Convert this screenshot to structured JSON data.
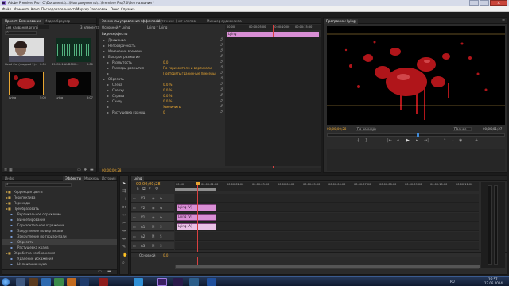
{
  "titlebar": {
    "title": "Adobe Premiere Pro - C:\\Documents\\...\\Мои документы\\...\\Premiere Pro\\7.0\\Без названия *"
  },
  "menu": [
    "Файл",
    "Изменить",
    "Клип",
    "Последовательность",
    "Маркер",
    "Заголовок",
    "Окно",
    "Справка"
  ],
  "project": {
    "tabs": [
      "Проект: Без названия",
      "Медиа-браузер"
    ],
    "field": "Без названия.prproj",
    "count": "3 элемента",
    "items": [
      {
        "name": "Head Cut (mapped 1)...",
        "meta": "0:00"
      },
      {
        "name": "69490-1-AUD000...",
        "meta": "0:00"
      },
      {
        "name": "Lying",
        "meta": "5:00"
      },
      {
        "name": "Lying",
        "meta": "5:07"
      }
    ]
  },
  "effect_controls": {
    "tabs": [
      "Элементы управления эффектами",
      "Источник: (нет клипов)",
      "Микшер аудиоклипа"
    ],
    "clip_label": "Основной * Lying",
    "seq_label": "Lying * Lying",
    "ruler": [
      "00:00",
      "00:00:05:00",
      "00:00:10:00",
      "00:00:15:00"
    ],
    "timebar_clip": "Lying",
    "header": "Видеоэффекты",
    "rows": [
      {
        "label": "Движение",
        "value": ""
      },
      {
        "label": "Непрозрачность",
        "value": ""
      },
      {
        "label": "Изменение времени",
        "value": ""
      },
      {
        "label": "Быстрое размытие",
        "value": ""
      },
      {
        "label": "Размытость",
        "value": "0.0"
      },
      {
        "label": "Размеры размытия",
        "value": "По горизонтали и вертикали"
      },
      {
        "label": "",
        "value": "Повторять граничные пикселы"
      },
      {
        "label": "Обрезать",
        "value": ""
      },
      {
        "label": "Слева",
        "value": "0.0 %"
      },
      {
        "label": "Сверху",
        "value": "0.0 %"
      },
      {
        "label": "Справа",
        "value": "0.0 %"
      },
      {
        "label": "Снизу",
        "value": "0.0 %"
      },
      {
        "label": "",
        "value": "Увеличить"
      },
      {
        "label": "Растушевка границ",
        "value": "0"
      }
    ],
    "timecode": "00;00;00;28"
  },
  "program": {
    "tab": "Программа: Lying",
    "timecode_left": "00;00;00;28",
    "fit": "По размеру",
    "quality": "Полное",
    "timecode_right": "00;00;01;27"
  },
  "effects": {
    "tabs": [
      "Инфо",
      "Эффекты",
      "Маркеры",
      "История"
    ],
    "search_placeholder": "",
    "items": [
      "Коррекция цвета",
      "Перспектива",
      "Переходы",
      "Преобразовать",
      "Вертикальное отражение",
      "Виньетирование",
      "Горизонтальное отражение",
      "Закругление по вертикали",
      "Закругление по горизонтали",
      "Обрезать",
      "Растушевка краев",
      "Обработка изображения",
      "Удаление искажений",
      "Наложение шума"
    ]
  },
  "timeline": {
    "tabs": [
      "Lying"
    ],
    "timecode": "00;00;00;28",
    "ruler": [
      "00:00",
      "00:00:01:00",
      "00:00:02:00",
      "00:00:03:00",
      "00:00:04:00",
      "00:00:05:00",
      "00:00:06:00",
      "00:00:07:00",
      "00:00:08:00",
      "00:00:09:00",
      "00:00:10:00",
      "00:00:11:00"
    ],
    "tracks": [
      "V3",
      "V2",
      "V1",
      "A1",
      "A2",
      "A3"
    ],
    "master": "Основной",
    "master_value": "0.0",
    "clips": [
      {
        "track": "V2",
        "label": "Lying [V]"
      },
      {
        "track": "V1",
        "label": "Lying [V]"
      },
      {
        "track": "A1",
        "label": "Lying [A]"
      }
    ]
  },
  "taskbar": {
    "lang": "RU",
    "time": "19:57",
    "date": "12.05.2014"
  },
  "colors": {
    "accent": "#e8a632",
    "clip_video": "#d98fd5",
    "clip_audio": "#e9c1e6",
    "playhead": "#d94040"
  }
}
